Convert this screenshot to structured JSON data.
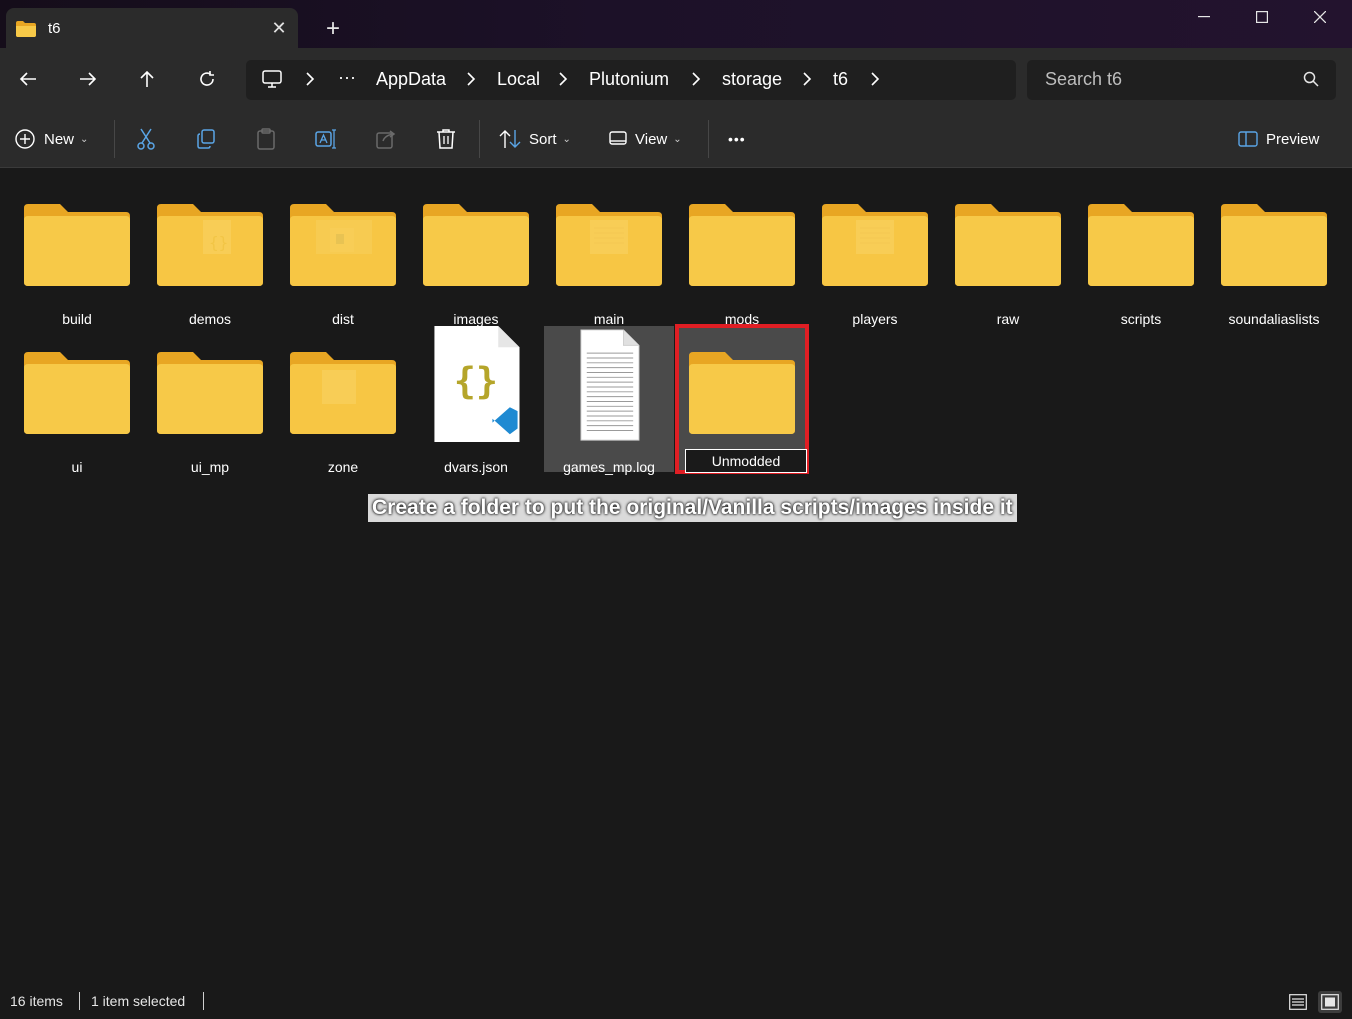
{
  "tab": {
    "title": "t6"
  },
  "window_controls": {
    "minimize": "—",
    "maximize": "☐",
    "close": "✕"
  },
  "breadcrumb": [
    "AppData",
    "Local",
    "Plutonium",
    "storage",
    "t6"
  ],
  "breadcrumb_overflow": "···",
  "search": {
    "placeholder": "Search t6"
  },
  "commands": {
    "new": "New",
    "sort": "Sort",
    "view": "View",
    "more": "•••",
    "preview": "Preview"
  },
  "items": [
    {
      "name": "build",
      "type": "folder",
      "content": "none"
    },
    {
      "name": "demos",
      "type": "folder",
      "content": "json"
    },
    {
      "name": "dist",
      "type": "folder",
      "content": "image"
    },
    {
      "name": "images",
      "type": "folder",
      "content": "none"
    },
    {
      "name": "main",
      "type": "folder",
      "content": "doc"
    },
    {
      "name": "mods",
      "type": "folder",
      "content": "none"
    },
    {
      "name": "players",
      "type": "folder",
      "content": "doc"
    },
    {
      "name": "raw",
      "type": "folder",
      "content": "none"
    },
    {
      "name": "scripts",
      "type": "folder",
      "content": "none"
    },
    {
      "name": "soundaliaslists",
      "type": "folder",
      "content": "none"
    },
    {
      "name": "ui",
      "type": "folder",
      "content": "none"
    },
    {
      "name": "ui_mp",
      "type": "folder",
      "content": "none"
    },
    {
      "name": "zone",
      "type": "folder",
      "content": "page"
    },
    {
      "name": "dvars.json",
      "type": "json"
    },
    {
      "name": "games_mp.log",
      "type": "log",
      "selected": true
    },
    {
      "name": "Unmodded",
      "type": "folder",
      "content": "none",
      "renaming": true
    }
  ],
  "caption": "Create a folder to put the original/Vanilla scripts/images inside it",
  "status": {
    "count": "16 items",
    "selected": "1 item selected"
  },
  "colors": {
    "highlight_border": "#e01e24",
    "folder": "#f7c948",
    "folder_back": "#e8a623"
  }
}
